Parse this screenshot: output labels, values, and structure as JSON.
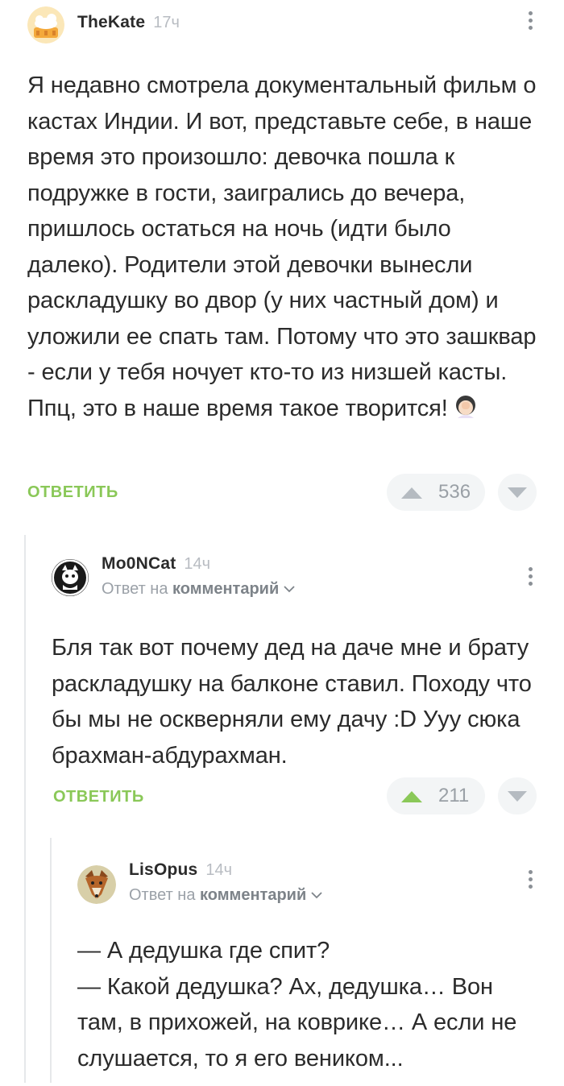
{
  "comments": [
    {
      "author": "TheKate",
      "time": "17ч",
      "paragraphs": [
        "Я недавно смотрела документальный фильм о кастах Индии. И вот, представьте себе, в наше время это произошло: девочка пошла к подружке в гости, заигрались до вечера, пришлось остаться на ночь (идти было далеко). Родители этой девочки вынесли раскладушку во двор (у них частный дом) и уложили ее спать там. Потому что это зашквар - если у тебя ночует кто-то из низшей касты. Ппц, это в наше время такое творится!"
      ],
      "emoji": "facepalm-emoji",
      "reply_label": "ОТВЕТИТЬ",
      "rating": "536"
    },
    {
      "author": "Mo0NCat",
      "time": "14ч",
      "reply_to_prefix": "Ответ на",
      "reply_to_link": "комментарий",
      "paragraphs": [
        "Бля так вот почему дед на даче мне и брату раскладушку на балконе ставил. Походу что бы мы не оскверняли ему дачу :D Ууу сюка брахман-абдурахман."
      ],
      "reply_label": "ОТВЕТИТЬ",
      "rating": "211"
    },
    {
      "author": "LisOpus",
      "time": "14ч",
      "reply_to_prefix": "Ответ на",
      "reply_to_link": "комментарий",
      "paragraphs": [
        "— А дедушка где спит?",
        "— Какой дедушка? Ах, дедушка… Вон там, в прихожей, на коврике… А если не слушается, то я его веником..."
      ]
    }
  ],
  "colors": {
    "accent_green": "#8ac858",
    "upvote_active": "#8ac858",
    "vote_inactive": "#b5bbc1",
    "thread_line": "#e6e8ea"
  }
}
